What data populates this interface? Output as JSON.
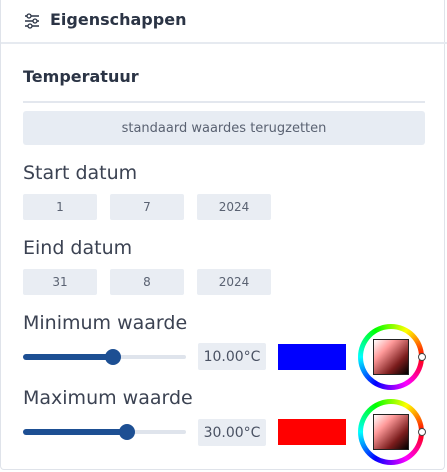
{
  "header": {
    "title": "Eigenschappen",
    "icon": "sliders-icon"
  },
  "section": {
    "title": "Temperatuur"
  },
  "reset_button": {
    "label": "standaard waardes terugzetten"
  },
  "start_date": {
    "label": "Start datum",
    "day": "1",
    "month": "7",
    "year": "2024"
  },
  "end_date": {
    "label": "Eind datum",
    "day": "31",
    "month": "8",
    "year": "2024"
  },
  "minimum": {
    "label": "Minimum waarde",
    "value_text": "10.00°C",
    "slider_fraction": 0.55,
    "color": "#0000ff"
  },
  "maximum": {
    "label": "Maximum waarde",
    "value_text": "30.00°C",
    "slider_fraction": 0.64,
    "color": "#ff0000"
  },
  "colors": {
    "accent": "#1d4f93",
    "box_bg": "#e9edf3"
  }
}
